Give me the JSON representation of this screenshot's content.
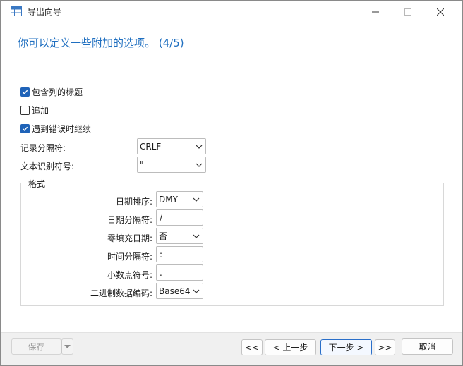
{
  "window": {
    "title": "导出向导"
  },
  "heading": "你可以定义一些附加的选项。 (4/5)",
  "options": {
    "include_headers": {
      "label": "包含列的标题",
      "checked": true
    },
    "append": {
      "label": "追加",
      "checked": false
    },
    "continue_on_error": {
      "label": "遇到错误时继续",
      "checked": true
    }
  },
  "record_delimiter": {
    "label": "记录分隔符:",
    "value": "CRLF"
  },
  "text_qualifier": {
    "label": "文本识别符号:",
    "value": "\""
  },
  "format": {
    "title": "格式",
    "date_order": {
      "label": "日期排序:",
      "value": "DMY"
    },
    "date_delimiter": {
      "label": "日期分隔符:",
      "value": "/"
    },
    "zero_padding_date": {
      "label": "零填充日期:",
      "value": "否"
    },
    "time_delimiter": {
      "label": "时间分隔符:",
      "value": ":"
    },
    "decimal_symbol": {
      "label": "小数点符号:",
      "value": "."
    },
    "binary_encoding": {
      "label": "二进制数据编码:",
      "value": "Base64"
    }
  },
  "footer": {
    "save_label": "保存",
    "first_label": "<<",
    "prev_label": "< 上一步",
    "next_label": "下一步 >",
    "last_label": ">>",
    "cancel_label": "取消"
  },
  "colors": {
    "accent": "#1f63b8",
    "heading": "#1f6fc0"
  }
}
